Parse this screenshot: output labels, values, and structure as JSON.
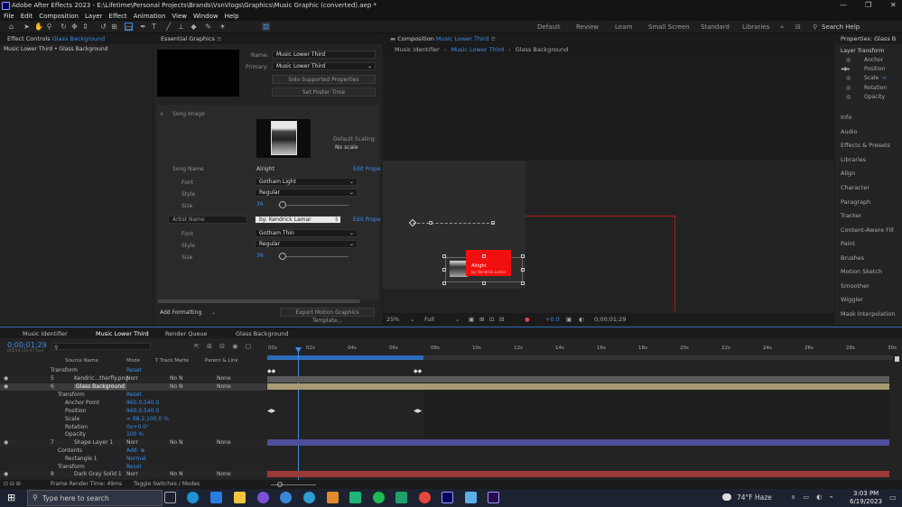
{
  "title_bar": {
    "text": "Adobe After Effects 2023 - E:\\Lifetime\\Personal Projects\\Brands\\VsnVlogs\\Graphics\\Music Graphic (converted).aep *",
    "minimize": "—",
    "maximize": "❐",
    "close": "✕"
  },
  "menu": [
    "File",
    "Edit",
    "Composition",
    "Layer",
    "Effect",
    "Animation",
    "View",
    "Window",
    "Help"
  ],
  "workspaces": [
    "Default",
    "Review",
    "Learn",
    "Small Screen",
    "Standard",
    "Libraries"
  ],
  "search_help": "Search Help",
  "effect_controls": {
    "tab": "Effect Controls",
    "layer": "Glass Background",
    "breadcrumb": "Music Lower Third • Glass Background"
  },
  "essential_graphics": {
    "tab": "Essential Graphics",
    "name_label": "Name:",
    "name_value": "Music Lower Third",
    "primary_label": "Primary:",
    "primary_value": "Music Lower Third",
    "solo_btn": "Solo Supported Properties",
    "poster_btn": "Set Poster Time",
    "song_image": "Song Image",
    "default_scaling_label": "Default Scaling:",
    "default_scaling_value": "No scale",
    "song_name_label": "Song Name",
    "song_name_value": "Alright",
    "edit_properties": "Edit Prope",
    "font_label": "Font",
    "song_font": "Gotham Light",
    "style_label": "Style",
    "song_style": "Regular",
    "size_label": "Size",
    "song_size": "36",
    "artist_name_label": "Artist Name",
    "artist_name_value": "by: Kendrick Lamar",
    "artist_font": "Gotham Thin",
    "artist_style": "Regular",
    "artist_size": "36",
    "add_formatting": "Add Formatting",
    "export_btn": "Export Motion Graphics Template..."
  },
  "composition": {
    "tab": "Composition",
    "comp_name": "Music Lower Third",
    "crumbs": [
      "Music Identifier",
      "Music Lower Third",
      "Glass Background"
    ],
    "zoom": "25%",
    "resolution": "Full",
    "exposure": "+0.0",
    "timecode": "0;00;01;29",
    "preview_title": "Alright",
    "preview_artist": "by: Kendrick Lamar"
  },
  "properties": {
    "title": "Properties: Glass B",
    "section": "Layer Transform",
    "items": [
      "Anchor",
      "Position",
      "Scale",
      "Rotation",
      "Opacity"
    ]
  },
  "right_panels": [
    "Info",
    "Audio",
    "Effects & Presets",
    "Libraries",
    "Align",
    "Character",
    "Paragraph",
    "Tracker",
    "Content-Aware Fill",
    "Paint",
    "Brushes",
    "Motion Sketch",
    "Smoother",
    "Wiggler",
    "Mask Interpolation"
  ],
  "timeline": {
    "tabs": [
      "Music Identifier",
      "Music Lower Third",
      "Render Queue",
      "Glass Background"
    ],
    "timecode": "0;00;01;29",
    "frame_info": "00059 (29.97 fps)",
    "col_source": "Source Name",
    "col_mode": "Mode",
    "col_trkmat": "T Track Matte",
    "col_parent": "Parent & Link",
    "ruler": [
      "00s",
      "02s",
      "04s",
      "06s",
      "08s",
      "10s",
      "12s",
      "14s",
      "16s",
      "18s",
      "20s",
      "22s",
      "24s",
      "26s",
      "28s",
      "30s"
    ],
    "rows": [
      {
        "num": "",
        "name": "Transform",
        "mode": "Reset",
        "trk": "",
        "parent": ""
      },
      {
        "num": "5",
        "name": "Kendric...therfly.png",
        "mode": "Norr",
        "trk": "No N",
        "parent": "None"
      },
      {
        "num": "6",
        "name": "Glass Background",
        "mode": "",
        "trk": "No N",
        "parent": "None"
      },
      {
        "num": "",
        "name": "Transform",
        "mode": "Reset",
        "trk": "",
        "parent": ""
      },
      {
        "num": "",
        "name": "Anchor Point",
        "mode": "960.0,540.0",
        "trk": "",
        "parent": ""
      },
      {
        "num": "",
        "name": "Position",
        "mode": "960.0,540.0",
        "trk": "",
        "parent": ""
      },
      {
        "num": "",
        "name": "Scale",
        "mode": "∞ 88.2,100.0 %",
        "trk": "",
        "parent": ""
      },
      {
        "num": "",
        "name": "Rotation",
        "mode": "0x+0.0°",
        "trk": "",
        "parent": ""
      },
      {
        "num": "",
        "name": "Opacity",
        "mode": "100 %",
        "trk": "",
        "parent": ""
      },
      {
        "num": "7",
        "name": "Shape Layer 1",
        "mode": "Norr",
        "trk": "No N",
        "parent": "None"
      },
      {
        "num": "",
        "name": "Contents",
        "mode": "Add: ⊕",
        "trk": "",
        "parent": ""
      },
      {
        "num": "",
        "name": "Rectangle 1",
        "mode": "Normal",
        "trk": "",
        "parent": ""
      },
      {
        "num": "",
        "name": "Transform",
        "mode": "Reset",
        "trk": "",
        "parent": ""
      },
      {
        "num": "8",
        "name": "Dark Gray Solid 1",
        "mode": "Norr",
        "trk": "No N",
        "parent": "None"
      }
    ],
    "footer": "Frame Render Time: 49ms",
    "toggle": "Toggle Switches / Modes"
  },
  "taskbar": {
    "search": "Type here to search",
    "weather": "74°F Haze",
    "time": "3:03 PM",
    "date": "6/19/2023"
  }
}
